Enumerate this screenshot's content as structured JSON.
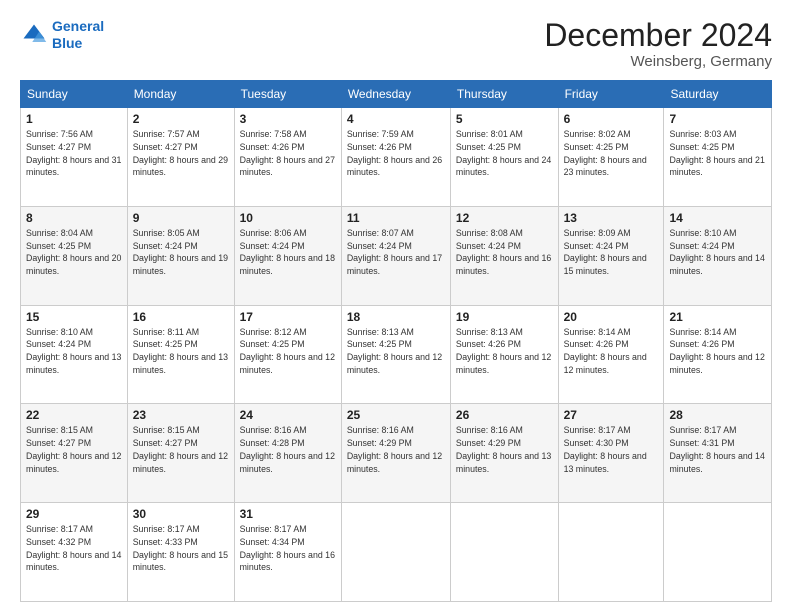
{
  "header": {
    "logo_line1": "General",
    "logo_line2": "Blue",
    "month_title": "December 2024",
    "location": "Weinsberg, Germany"
  },
  "days_of_week": [
    "Sunday",
    "Monday",
    "Tuesday",
    "Wednesday",
    "Thursday",
    "Friday",
    "Saturday"
  ],
  "weeks": [
    [
      {
        "day": "1",
        "sunrise": "7:56 AM",
        "sunset": "4:27 PM",
        "daylight": "8 hours and 31 minutes."
      },
      {
        "day": "2",
        "sunrise": "7:57 AM",
        "sunset": "4:27 PM",
        "daylight": "8 hours and 29 minutes."
      },
      {
        "day": "3",
        "sunrise": "7:58 AM",
        "sunset": "4:26 PM",
        "daylight": "8 hours and 27 minutes."
      },
      {
        "day": "4",
        "sunrise": "7:59 AM",
        "sunset": "4:26 PM",
        "daylight": "8 hours and 26 minutes."
      },
      {
        "day": "5",
        "sunrise": "8:01 AM",
        "sunset": "4:25 PM",
        "daylight": "8 hours and 24 minutes."
      },
      {
        "day": "6",
        "sunrise": "8:02 AM",
        "sunset": "4:25 PM",
        "daylight": "8 hours and 23 minutes."
      },
      {
        "day": "7",
        "sunrise": "8:03 AM",
        "sunset": "4:25 PM",
        "daylight": "8 hours and 21 minutes."
      }
    ],
    [
      {
        "day": "8",
        "sunrise": "8:04 AM",
        "sunset": "4:25 PM",
        "daylight": "8 hours and 20 minutes."
      },
      {
        "day": "9",
        "sunrise": "8:05 AM",
        "sunset": "4:24 PM",
        "daylight": "8 hours and 19 minutes."
      },
      {
        "day": "10",
        "sunrise": "8:06 AM",
        "sunset": "4:24 PM",
        "daylight": "8 hours and 18 minutes."
      },
      {
        "day": "11",
        "sunrise": "8:07 AM",
        "sunset": "4:24 PM",
        "daylight": "8 hours and 17 minutes."
      },
      {
        "day": "12",
        "sunrise": "8:08 AM",
        "sunset": "4:24 PM",
        "daylight": "8 hours and 16 minutes."
      },
      {
        "day": "13",
        "sunrise": "8:09 AM",
        "sunset": "4:24 PM",
        "daylight": "8 hours and 15 minutes."
      },
      {
        "day": "14",
        "sunrise": "8:10 AM",
        "sunset": "4:24 PM",
        "daylight": "8 hours and 14 minutes."
      }
    ],
    [
      {
        "day": "15",
        "sunrise": "8:10 AM",
        "sunset": "4:24 PM",
        "daylight": "8 hours and 13 minutes."
      },
      {
        "day": "16",
        "sunrise": "8:11 AM",
        "sunset": "4:25 PM",
        "daylight": "8 hours and 13 minutes."
      },
      {
        "day": "17",
        "sunrise": "8:12 AM",
        "sunset": "4:25 PM",
        "daylight": "8 hours and 12 minutes."
      },
      {
        "day": "18",
        "sunrise": "8:13 AM",
        "sunset": "4:25 PM",
        "daylight": "8 hours and 12 minutes."
      },
      {
        "day": "19",
        "sunrise": "8:13 AM",
        "sunset": "4:26 PM",
        "daylight": "8 hours and 12 minutes."
      },
      {
        "day": "20",
        "sunrise": "8:14 AM",
        "sunset": "4:26 PM",
        "daylight": "8 hours and 12 minutes."
      },
      {
        "day": "21",
        "sunrise": "8:14 AM",
        "sunset": "4:26 PM",
        "daylight": "8 hours and 12 minutes."
      }
    ],
    [
      {
        "day": "22",
        "sunrise": "8:15 AM",
        "sunset": "4:27 PM",
        "daylight": "8 hours and 12 minutes."
      },
      {
        "day": "23",
        "sunrise": "8:15 AM",
        "sunset": "4:27 PM",
        "daylight": "8 hours and 12 minutes."
      },
      {
        "day": "24",
        "sunrise": "8:16 AM",
        "sunset": "4:28 PM",
        "daylight": "8 hours and 12 minutes."
      },
      {
        "day": "25",
        "sunrise": "8:16 AM",
        "sunset": "4:29 PM",
        "daylight": "8 hours and 12 minutes."
      },
      {
        "day": "26",
        "sunrise": "8:16 AM",
        "sunset": "4:29 PM",
        "daylight": "8 hours and 13 minutes."
      },
      {
        "day": "27",
        "sunrise": "8:17 AM",
        "sunset": "4:30 PM",
        "daylight": "8 hours and 13 minutes."
      },
      {
        "day": "28",
        "sunrise": "8:17 AM",
        "sunset": "4:31 PM",
        "daylight": "8 hours and 14 minutes."
      }
    ],
    [
      {
        "day": "29",
        "sunrise": "8:17 AM",
        "sunset": "4:32 PM",
        "daylight": "8 hours and 14 minutes."
      },
      {
        "day": "30",
        "sunrise": "8:17 AM",
        "sunset": "4:33 PM",
        "daylight": "8 hours and 15 minutes."
      },
      {
        "day": "31",
        "sunrise": "8:17 AM",
        "sunset": "4:34 PM",
        "daylight": "8 hours and 16 minutes."
      },
      null,
      null,
      null,
      null
    ]
  ],
  "labels": {
    "sunrise": "Sunrise:",
    "sunset": "Sunset:",
    "daylight": "Daylight:"
  }
}
